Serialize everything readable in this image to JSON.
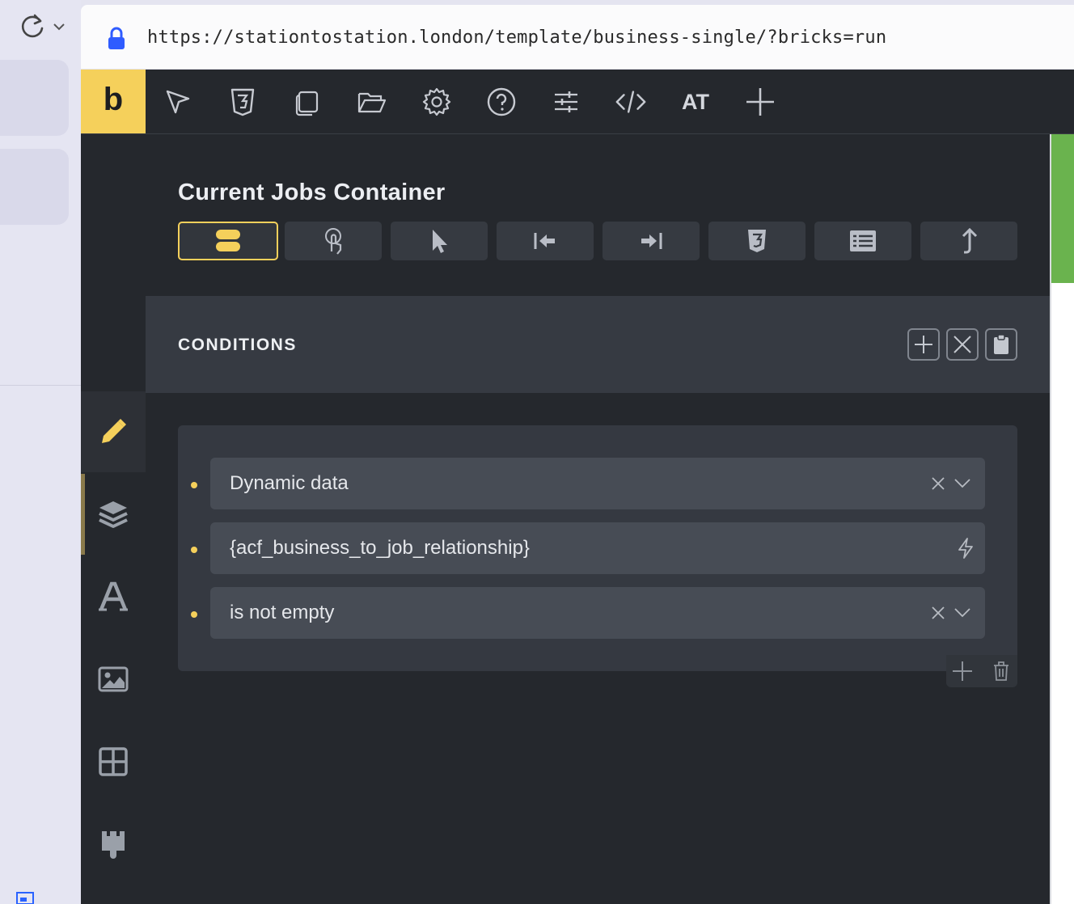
{
  "browser": {
    "url": "https://stationtostation.london/template/business-single/?bricks=run"
  },
  "toolbar": {
    "logo": "b",
    "at_label": "AT",
    "icons": [
      "cursor-icon",
      "css3-icon",
      "pages-icon",
      "folder-icon",
      "settings-icon",
      "help-icon",
      "sliders-icon",
      "code-icon",
      "plus-icon"
    ]
  },
  "sidebar": {
    "items": [
      "edit-icon",
      "layers-icon",
      "typography-icon",
      "image-icon",
      "grid-icon",
      "brush-icon"
    ]
  },
  "panel": {
    "title": "Current Jobs Container",
    "tabs": [
      "conditions-tab",
      "interactions-tab",
      "pointer-tab",
      "previous-tab",
      "next-tab",
      "css-tab",
      "list-tab",
      "export-tab"
    ]
  },
  "conditions": {
    "header": "CONDITIONS",
    "rows": [
      {
        "value": "Dynamic data",
        "type": "select"
      },
      {
        "value": "{acf_business_to_job_relationship}",
        "type": "dynamic"
      },
      {
        "value": "is not empty",
        "type": "select"
      }
    ]
  },
  "colors": {
    "accent": "#f5d05b",
    "background": "#25282d",
    "green": "#6ab34e"
  }
}
